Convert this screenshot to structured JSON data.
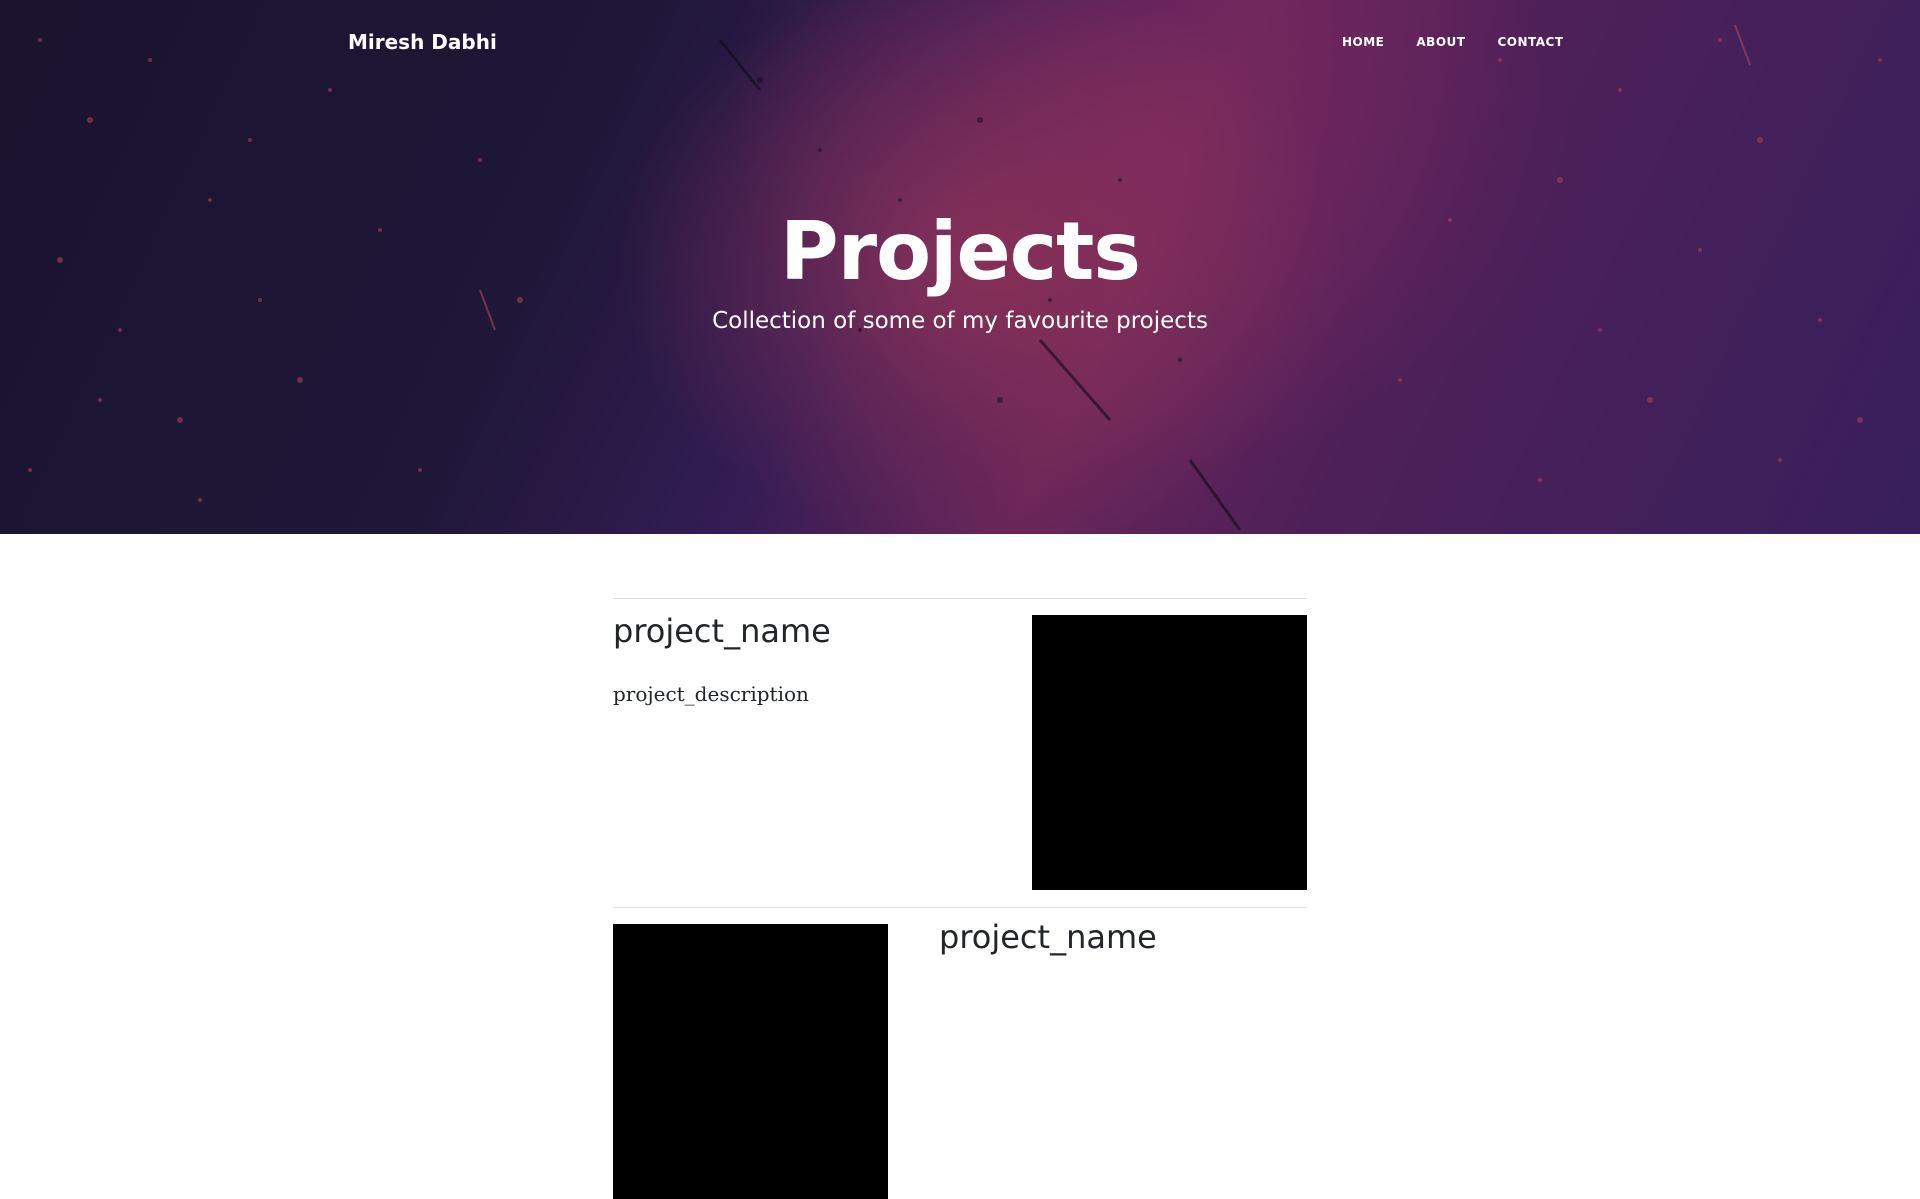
{
  "navbar": {
    "brand": "Miresh Dabhi",
    "links": [
      {
        "label": "HOME"
      },
      {
        "label": "ABOUT"
      },
      {
        "label": "CONTACT"
      }
    ]
  },
  "hero": {
    "title": "Projects",
    "subtitle": "Collection of some of my favourite projects"
  },
  "projects": [
    {
      "name": "project_name",
      "description": "project_description"
    },
    {
      "name": "project_name"
    }
  ],
  "colors": {
    "hero_background": "#3b2160",
    "text": "#212529",
    "image_placeholder": "#000000"
  }
}
